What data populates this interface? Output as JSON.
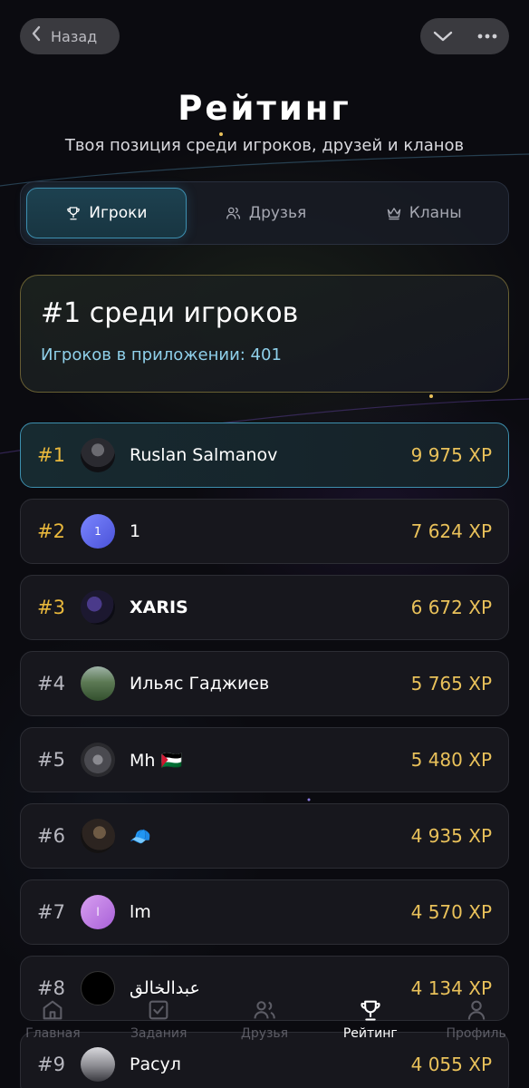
{
  "header": {
    "back_label": "Назад",
    "title": "Рейтинг",
    "subtitle": "Твоя позиция среди игроков, друзей и кланов"
  },
  "tabs": [
    {
      "label": "Игроки",
      "icon": "trophy-icon",
      "active": true
    },
    {
      "label": "Друзья",
      "icon": "users-icon",
      "active": false
    },
    {
      "label": "Кланы",
      "icon": "crown-icon",
      "active": false
    }
  ],
  "summary": {
    "title": "#1 среди игроков",
    "subtitle": "Игроков в приложении: 401"
  },
  "leaderboard": [
    {
      "pos": "#1",
      "name": "Ruslan Salmanov",
      "xp": "9 975 XP",
      "avatar": "photo"
    },
    {
      "pos": "#2",
      "name": "1",
      "xp": "7 624 XP",
      "avatar": "1"
    },
    {
      "pos": "#3",
      "name": "XARIS",
      "xp": "6 672 XP",
      "avatar": "photo"
    },
    {
      "pos": "#4",
      "name": "Ильяс Гаджиев",
      "xp": "5 765 XP",
      "avatar": "photo"
    },
    {
      "pos": "#5",
      "name": "Mh 🇵🇸",
      "xp": "5 480 XP",
      "avatar": "photo"
    },
    {
      "pos": "#6",
      "name": "🧢",
      "xp": "4 935 XP",
      "avatar": "photo"
    },
    {
      "pos": "#7",
      "name": "lm",
      "xp": "4 570 XP",
      "avatar": "l"
    },
    {
      "pos": "#8",
      "name": "عبدالخالق",
      "xp": "4 134 XP",
      "avatar": "photo"
    },
    {
      "pos": "#9",
      "name": "Расул",
      "xp": "4 055 XP",
      "avatar": "photo"
    }
  ],
  "nav": [
    {
      "label": "Главная",
      "icon": "home-icon",
      "active": false
    },
    {
      "label": "Задания",
      "icon": "tasks-icon",
      "active": false
    },
    {
      "label": "Друзья",
      "icon": "friends-icon",
      "active": false
    },
    {
      "label": "Рейтинг",
      "icon": "trophy-icon",
      "active": true
    },
    {
      "label": "Профиль",
      "icon": "profile-icon",
      "active": false
    }
  ],
  "colors": {
    "background": "#0b0b10",
    "accent_blue": "#3d8fb0",
    "xp_gold": "#e9c15a",
    "rank_gold": "#e9b83c",
    "rank_gray": "#b8b8c0"
  }
}
